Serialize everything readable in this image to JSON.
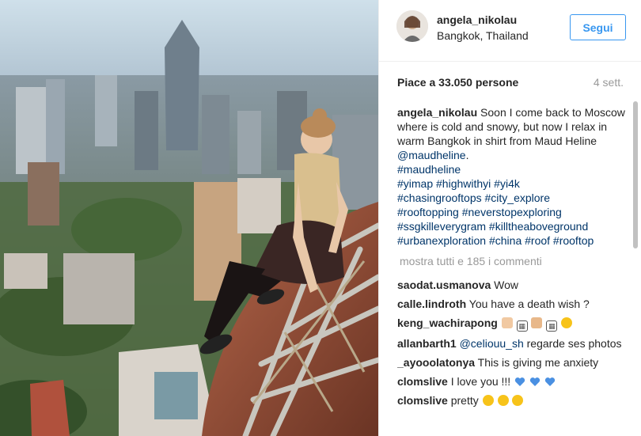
{
  "post": {
    "author": "angela_nikolau",
    "location": "Bangkok, Thailand",
    "follow_label": "Segui",
    "likes": "Piace a 33.050 persone",
    "age": "4 sett.",
    "caption_user": "angela_nikolau",
    "caption_text": "Soon I come back to Moscow where is cold and snowy, but now I relax in warm Bangkok in shirt from Maud Heline",
    "caption_mention": "@maudheline",
    "caption_end": ".",
    "hashtag_lines": [
      "#maudheline",
      "#yimap #highwithyi #yi4k",
      "#chasingrooftops #city_explore",
      "#rooftopping #neverstopexploring",
      "#ssgkilleverygram #killtheaboveground",
      "#urbanexploration #china #roof #rooftop"
    ],
    "show_all": "mostra tutti e 185 i commenti"
  },
  "comments": [
    {
      "user": "saodat.usmanova",
      "text": "Wow"
    },
    {
      "user": "calle.lindroth",
      "text": "You have a death wish ?"
    },
    {
      "user": "keng_wachirapong",
      "text": ""
    },
    {
      "user": "allanbarth1",
      "mention": "@celiouu_sh",
      "text": "regarde ses photos"
    },
    {
      "user": "_ayooolatonya",
      "text": "This is giving me anxiety"
    },
    {
      "user": "clomslive",
      "text": "I love you !!!"
    },
    {
      "user": "clomslive",
      "text": "pretty"
    }
  ],
  "icons": {
    "keng_emoji": [
      "thumbs-up-icon",
      "box-icon",
      "clap-icon",
      "box-icon",
      "grimace-face-icon"
    ],
    "clomslive_love_emoji": [
      "blue-heart-icon",
      "blue-heart-icon",
      "blue-heart-icon"
    ],
    "clomslive_pretty_emoji": [
      "smile-face-icon",
      "smile-face-icon",
      "smile-face-icon"
    ]
  },
  "colors": {
    "follow_blue": "#3897f0",
    "hashtag_blue": "#003569",
    "muted_gray": "#999999",
    "heart_blue": "#4a90e2"
  }
}
